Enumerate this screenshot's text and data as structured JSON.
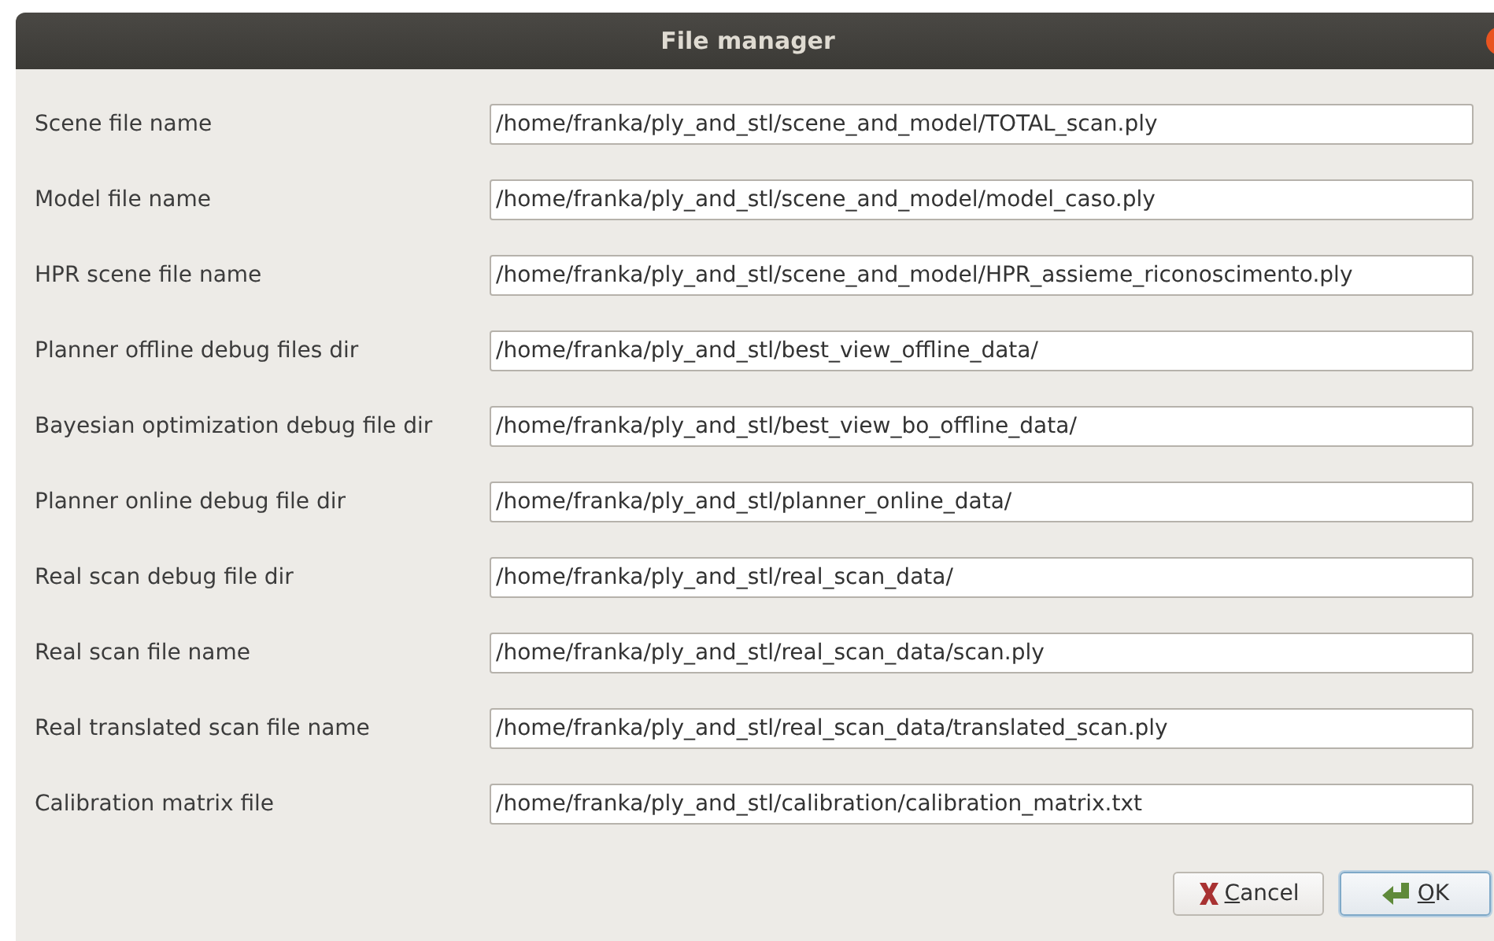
{
  "window": {
    "title": "File manager"
  },
  "fields": [
    {
      "label": "Scene file name",
      "value": "/home/franka/ply_and_stl/scene_and_model/TOTAL_scan.ply"
    },
    {
      "label": "Model file name",
      "value": "/home/franka/ply_and_stl/scene_and_model/model_caso.ply"
    },
    {
      "label": "HPR scene file name",
      "value": "/home/franka/ply_and_stl/scene_and_model/HPR_assieme_riconoscimento.ply"
    },
    {
      "label": "Planner offline debug files dir",
      "value": "/home/franka/ply_and_stl/best_view_offline_data/"
    },
    {
      "label": "Bayesian optimization debug file dir",
      "value": "/home/franka/ply_and_stl/best_view_bo_offline_data/"
    },
    {
      "label": "Planner online debug file dir",
      "value": "/home/franka/ply_and_stl/planner_online_data/"
    },
    {
      "label": "Real scan debug file dir",
      "value": "/home/franka/ply_and_stl/real_scan_data/"
    },
    {
      "label": "Real scan file name",
      "value": "/home/franka/ply_and_stl/real_scan_data/scan.ply"
    },
    {
      "label": "Real translated scan file name",
      "value": "/home/franka/ply_and_stl/real_scan_data/translated_scan.ply"
    },
    {
      "label": "Calibration matrix file",
      "value": "/home/franka/ply_and_stl/calibration/calibration_matrix.txt"
    }
  ],
  "buttons": [
    {
      "kind": "cancel",
      "label": "Cancel",
      "first_letter_underlined": true,
      "selected": false
    },
    {
      "kind": "ok",
      "label": "OK",
      "first_letter_underlined": true,
      "selected": true
    }
  ]
}
